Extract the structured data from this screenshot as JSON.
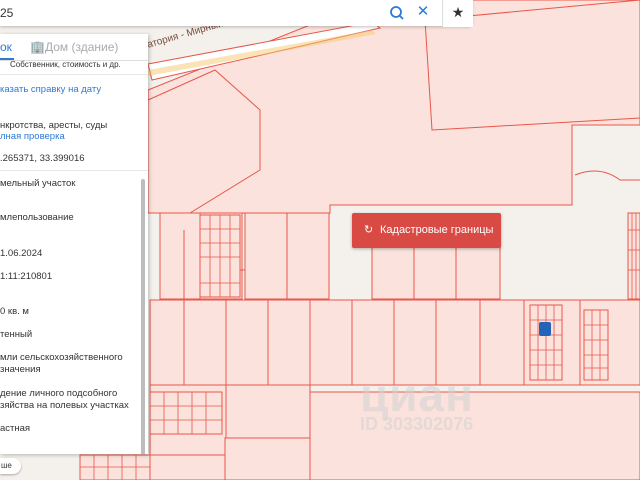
{
  "search": {
    "query_fragment": "25"
  },
  "tabs": {
    "active": "ок",
    "inactive": "Дом (здание)"
  },
  "panel": {
    "line_owner": "Собственник, стоимость и др.",
    "line_report": "казать справку на дату",
    "line_bankruptcy": "нкротства, аресты, суды",
    "line_check": "лная проверка",
    "coords": ".265371, 33.399016",
    "category": "мельный участок",
    "use": "млепользование",
    "date": "1.06.2024",
    "cadnum": "1:11:210801",
    "area": "0 кв. м",
    "status": "тенный",
    "land_cat_1": "мли сельскохозяйственного",
    "land_cat_2": "значения",
    "permitted_1": "дение личного подсобного",
    "permitted_2": "зяйства на полевых участках",
    "ownership": "астная"
  },
  "map": {
    "road_label": "атория - Мирный",
    "badge_label": "Кадастровые границы",
    "badge_icon": "refresh-icon",
    "chip_label": "ше",
    "watermark_big": "циан",
    "watermark_small": "ID 303302076",
    "colors": {
      "parcel_fill": "#fbe2dc",
      "parcel_stroke": "#e8574a",
      "badge": "#d94a45",
      "accent": "#2b7bd6"
    }
  }
}
